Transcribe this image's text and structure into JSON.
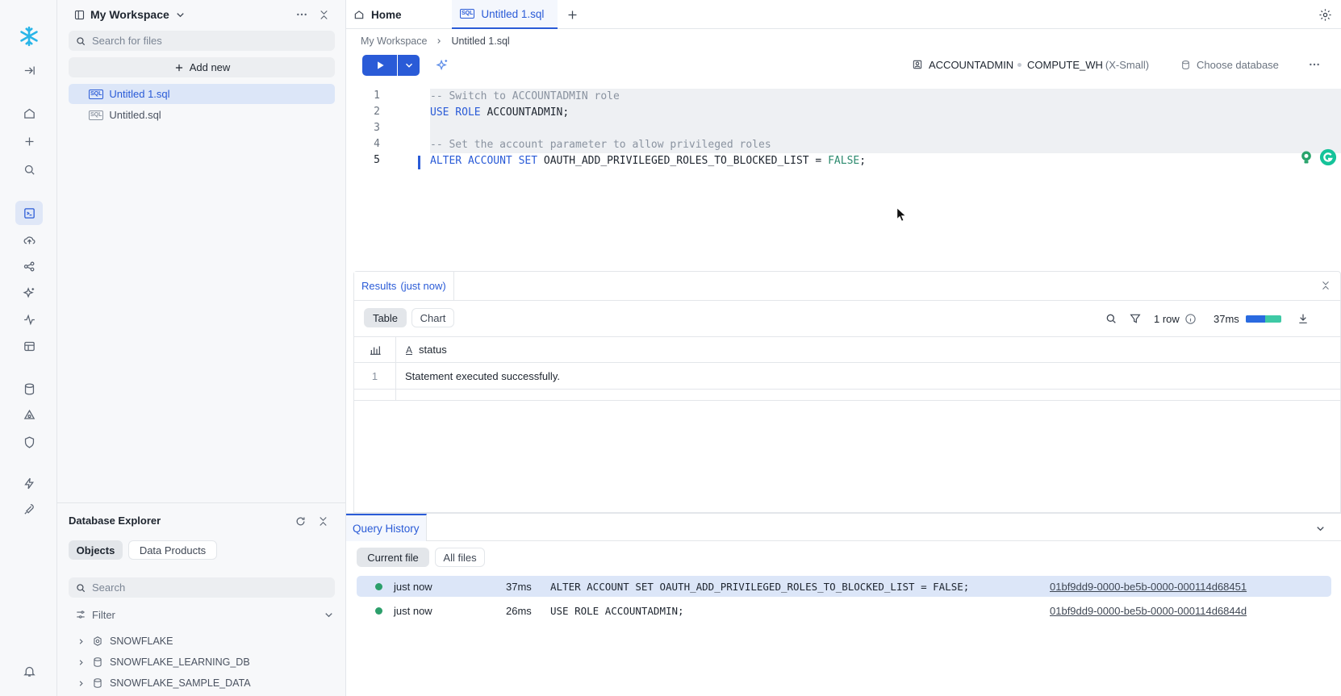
{
  "colors": {
    "accent": "#2a5bd7",
    "success": "#2c9f6b",
    "logo": "#29b5e8"
  },
  "rail": {
    "items": [
      "logo-icon",
      "collapse-icon",
      "home-icon",
      "plus-icon",
      "search-icon",
      "worksheet-icon",
      "upload-icon",
      "data-icon",
      "ai-icon",
      "monitoring-icon",
      "marketplace-icon",
      "database-icon",
      "catalog-icon",
      "shield-icon",
      "projects-icon",
      "admin-icon",
      "bell-icon"
    ]
  },
  "sidebar": {
    "workspace_title": "My Workspace",
    "search_placeholder": "Search for files",
    "add_new": "Add new",
    "files": [
      {
        "label": "Untitled 1.sql",
        "active": true
      },
      {
        "label": "Untitled.sql",
        "active": false
      }
    ]
  },
  "db_explorer": {
    "title": "Database Explorer",
    "tabs": [
      "Objects",
      "Data Products"
    ],
    "search_placeholder": "Search",
    "filter": "Filter",
    "items": [
      "SNOWFLAKE",
      "SNOWFLAKE_LEARNING_DB",
      "SNOWFLAKE_SAMPLE_DATA"
    ]
  },
  "tabs": [
    {
      "label": "Home"
    },
    {
      "label": "Untitled 1.sql",
      "active": true
    }
  ],
  "breadcrumb": {
    "parent": "My Workspace",
    "current": "Untitled 1.sql"
  },
  "context": {
    "role": "ACCOUNTADMIN",
    "warehouse": "COMPUTE_WH",
    "size": "(X-Small)",
    "database": "Choose database"
  },
  "editor": {
    "line_numbers": [
      "1",
      "2",
      "3",
      "4",
      "5"
    ],
    "lines": [
      "-- Switch to ACCOUNTADMIN role",
      "USE ROLE ACCOUNTADMIN;",
      "",
      "-- Set the account parameter to allow privileged roles",
      "ALTER ACCOUNT SET OAUTH_ADD_PRIVILEGED_ROLES_TO_BLOCKED_LIST = FALSE;"
    ],
    "tokens": {
      "use_kw": "USE ROLE",
      "use_id": "ACCOUNTADMIN;",
      "alter_kw": "ALTER ACCOUNT SET",
      "alter_id": "OAUTH_ADD_PRIVILEGED_ROLES_TO_BLOCKED_LIST = ",
      "alter_val": "FALSE",
      "alter_end": ";"
    }
  },
  "results": {
    "tab_label": "Results",
    "tab_time": "(just now)",
    "views": [
      "Table",
      "Chart"
    ],
    "row_count": "1 row",
    "duration": "37ms",
    "duration_fill": 0.55,
    "column": "status",
    "rows": [
      {
        "index": "1",
        "status": "Statement executed successfully."
      }
    ]
  },
  "query_history": {
    "title": "Query History",
    "filters": [
      "Current file",
      "All files"
    ],
    "rows": [
      {
        "time": "just now",
        "duration": "37ms",
        "sql": "ALTER ACCOUNT SET OAUTH_ADD_PRIVILEGED_ROLES_TO_BLOCKED_LIST = FALSE;",
        "id": "01bf9dd9-0000-be5b-0000-000114d68451",
        "selected": true
      },
      {
        "time": "just now",
        "duration": "26ms",
        "sql": "USE ROLE ACCOUNTADMIN;",
        "id": "01bf9dd9-0000-be5b-0000-000114d6844d",
        "selected": false
      }
    ]
  }
}
